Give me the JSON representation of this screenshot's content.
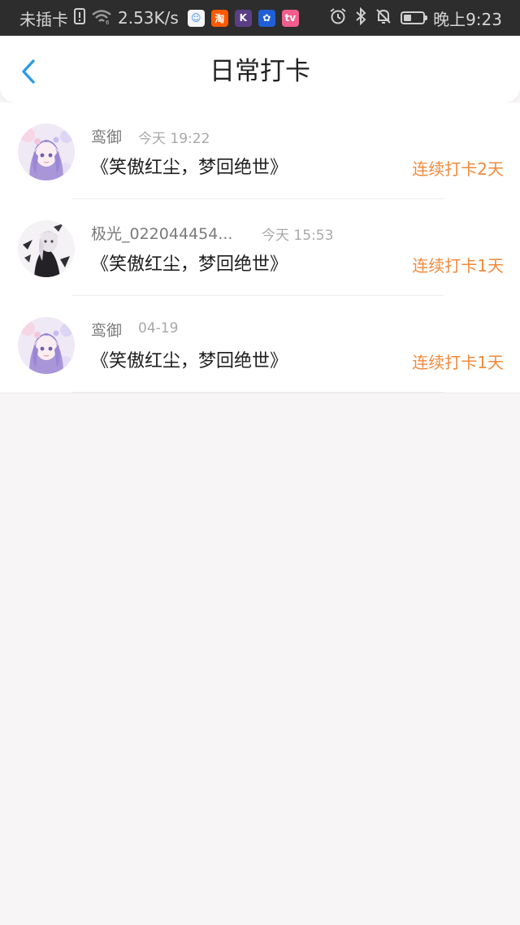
{
  "status_bar": {
    "carrier": "未插卡",
    "speed": "2.53K/s",
    "apps": [
      {
        "name": "tieba-icon",
        "glyph": "☺",
        "color": "#f5f5f5",
        "fg": "#3a8fe6"
      },
      {
        "name": "taobao-icon",
        "glyph": "淘",
        "color": "#ff5a00",
        "fg": "#ffffff"
      },
      {
        "name": "k-app-icon",
        "glyph": "K",
        "color": "#5b3f86",
        "fg": "#ffffff"
      },
      {
        "name": "bulb-app-icon",
        "glyph": "✿",
        "color": "#1f5fd6",
        "fg": "#ffffff"
      },
      {
        "name": "bilibili-icon",
        "glyph": "tv",
        "color": "#f25d8e",
        "fg": "#ffffff"
      }
    ],
    "time": "晚上9:23",
    "battery_level": 0.4
  },
  "nav": {
    "title": "日常打卡",
    "accent": "#2b9be8"
  },
  "checkins": [
    {
      "username": "鸾御",
      "time": "今天 19:22",
      "title": "《笑傲红尘，梦回绝世》",
      "streak": "连续打卡2天",
      "avatar_style": "light"
    },
    {
      "username": "极光_022044454...",
      "time": "今天 15:53",
      "title": "《笑傲红尘，梦回绝世》",
      "streak": "连续打卡1天",
      "avatar_style": "dark"
    },
    {
      "username": "鸾御",
      "time": "04-19",
      "title": "《笑傲红尘，梦回绝世》",
      "streak": "连续打卡1天",
      "avatar_style": "light"
    }
  ],
  "colors": {
    "streak": "#ef8a3c",
    "page_background": "#f7f5f6"
  }
}
